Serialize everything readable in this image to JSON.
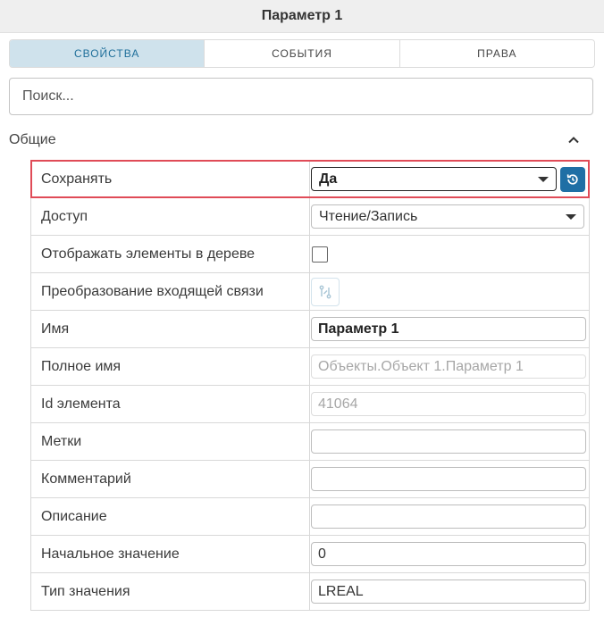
{
  "header": {
    "title": "Параметр 1"
  },
  "tabs": [
    {
      "label": "СВОЙСТВА",
      "active": true
    },
    {
      "label": "СОБЫТИЯ",
      "active": false
    },
    {
      "label": "ПРАВА",
      "active": false
    }
  ],
  "search": {
    "placeholder": "Поиск..."
  },
  "section": {
    "title": "Общие"
  },
  "properties": {
    "save": {
      "label": "Сохранять",
      "value": "Да"
    },
    "access": {
      "label": "Доступ",
      "value": "Чтение/Запись"
    },
    "show_in_tree": {
      "label": "Отображать элементы в дереве"
    },
    "incoming_link": {
      "label": "Преобразование входящей связи"
    },
    "name": {
      "label": "Имя",
      "value": "Параметр 1"
    },
    "full_name": {
      "label": "Полное имя",
      "value": "Объекты.Объект 1.Параметр 1"
    },
    "element_id": {
      "label": "Id элемента",
      "value": "41064"
    },
    "tags": {
      "label": "Метки",
      "value": ""
    },
    "comment": {
      "label": "Комментарий",
      "value": ""
    },
    "description": {
      "label": "Описание",
      "value": ""
    },
    "initial_value": {
      "label": "Начальное значение",
      "value": "0"
    },
    "value_type": {
      "label": "Тип значения",
      "value": "LREAL"
    }
  }
}
